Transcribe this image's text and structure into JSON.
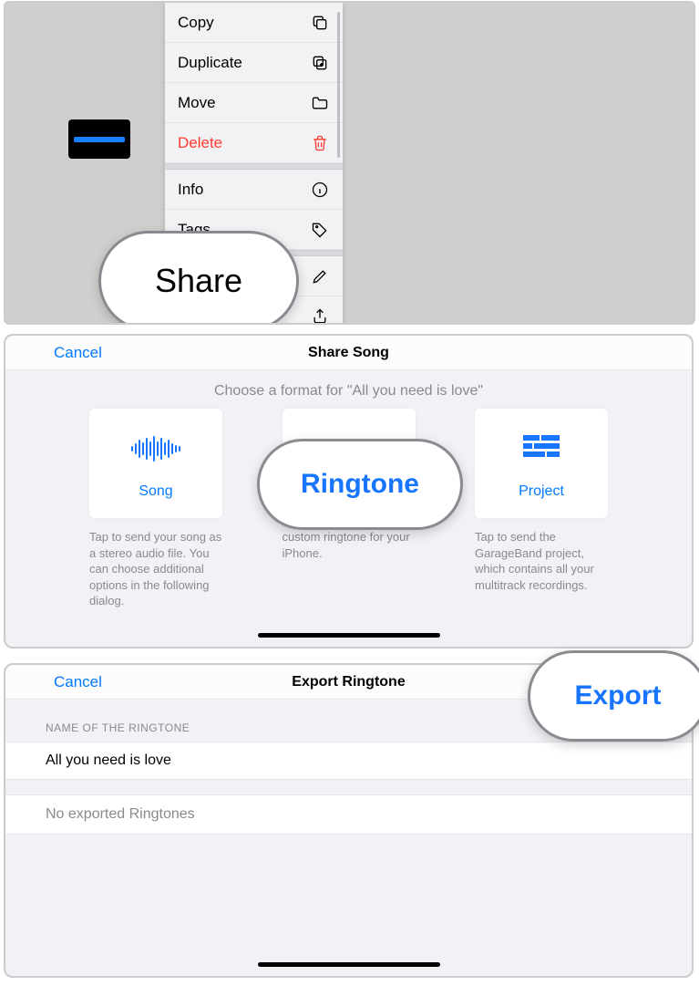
{
  "panel1": {
    "menu": {
      "copy_label": "Copy",
      "duplicate_label": "Duplicate",
      "move_label": "Move",
      "delete_label": "Delete",
      "info_label": "Info",
      "tags_label": "Tags"
    },
    "callout_label": "Share"
  },
  "panel2": {
    "cancel_label": "Cancel",
    "title": "Share Song",
    "prompt": "Choose a format for \"All you need is love\"",
    "card_song_label": "Song",
    "card_song_desc": "Tap to send your song as a stereo audio file. You can choose additional options in the following dialog.",
    "card_ringtone_desc": "custom ringtone for your iPhone.",
    "card_project_label": "Project",
    "card_project_desc": "Tap to send the GarageBand project, which contains all your multitrack recordings.",
    "callout_label": "Ringtone"
  },
  "panel3": {
    "cancel_label": "Cancel",
    "title": "Export Ringtone",
    "section_label": "NAME OF THE RINGTONE",
    "ringtone_name": "All you need is love",
    "status_text": "No exported Ringtones",
    "callout_label": "Export"
  }
}
